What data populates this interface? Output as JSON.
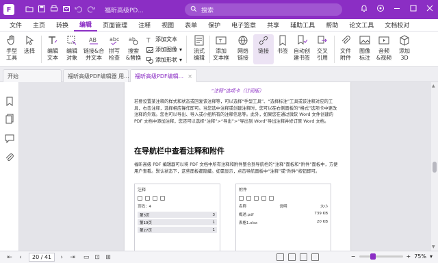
{
  "titlebar": {
    "logo": "F",
    "doc_title": "福昕高级PD...",
    "search_placeholder": "搜索",
    "accent": "#8b2ec4",
    "icons": [
      "folder-icon",
      "save-icon",
      "print-icon",
      "email-icon",
      "undo-icon",
      "redo-icon",
      "search-icon",
      "bell-icon",
      "notification-icon",
      "minimize-icon",
      "maximize-icon",
      "close-icon"
    ]
  },
  "menu": [
    "文件",
    "主页",
    "转换",
    "编辑",
    "页面管理",
    "注释",
    "视图",
    "表单",
    "保护",
    "电子签章",
    "共享",
    "辅助工具",
    "帮助",
    "论文工具",
    "文档校对"
  ],
  "menu_active_index": 3,
  "ribbon": {
    "hand": "手型\n工具",
    "select": "选择",
    "edit_text": "编辑\n文本",
    "edit_object": "编辑\n对象",
    "link_merge": "链接&合\n并文本",
    "spell_check": "拼写\n检查",
    "find_replace": "搜索\n&替换",
    "add_text": "添加文本",
    "add_image": "添加图像",
    "add_shape": "添加形状",
    "reflow_edit": "流式\n编辑",
    "add_textbox": "添加\n文本框",
    "web_link": "网络\n链接",
    "link": "链接",
    "bookmark": "书签",
    "auto_bookmark": "自动创\n建书签",
    "cross_ref": "交叉\n引用",
    "file_attach": "文件\n附件",
    "image_note": "图像\n标注",
    "audio_video": "音频\n&视频",
    "add_3d": "添加\n3D"
  },
  "tabs": [
    {
      "label": "开始"
    },
    {
      "label": "福昕高级PDF编辑器 用..."
    },
    {
      "label": "福昕高级PDF编辑..."
    }
  ],
  "document": {
    "subtitle": "“注释”选项卡（订阅版）",
    "p1": "若要设置某注释的样式和状态或回复该注释等，可以选择“手型工具”、“选择标注”工具或该注释对应的工具，右击注释，选择相应操作即可。当您选中注释或创建注释时，您可以在右侧面板的“格式”选项卡中更改注释的外观。您也可以导出、导入或小组所有的注释信息等。此外，如果您在通过微软 Word 文件创建的 PDF 文档中添加注释，您还可以选择“注释”>“导出”>“导出到 Word”导出注释并修订原 Word 文档。",
    "heading": "在导航栏中查看注释和附件",
    "p2": "福昕高级 PDF 编辑器可以将 PDF 文档中所有注释和附件整合到导航栏的“注释”面板和“附件”面板中，方便用户查看。默认状态下，这些面板都隐藏。如需显示，点击导航面板中“注释”或“附件”按钮即可。",
    "comments_panel": {
      "title": "注释",
      "count_label": "页码：4",
      "rows": [
        {
          "label": "第3页",
          "count": "3"
        },
        {
          "label": "第19页",
          "count": "1"
        },
        {
          "label": "第27页",
          "count": "1"
        }
      ]
    },
    "attach_panel": {
      "title": "附件",
      "col_name": "名称",
      "col_desc": "说明",
      "col_size": "大小",
      "files": [
        {
          "name": "概述.pdf",
          "size": "739 KB"
        },
        {
          "name": "表格1.xlsx",
          "size": "20 KB"
        }
      ]
    }
  },
  "statusbar": {
    "page": "20 / 41",
    "zoom": "75%",
    "zoom_fraction": 0.75
  }
}
